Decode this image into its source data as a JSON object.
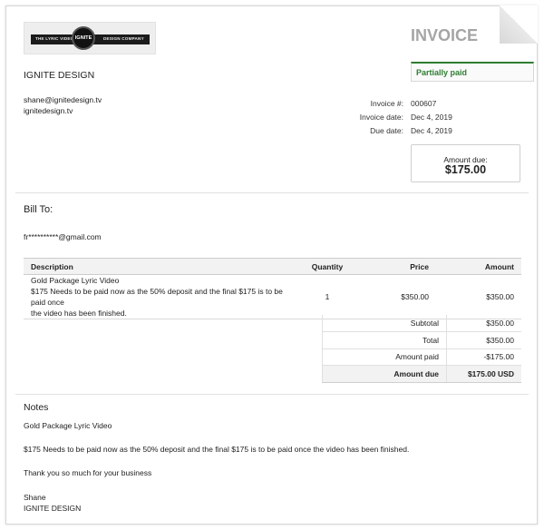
{
  "logo": {
    "left_text": "THE LYRIC VIDEO",
    "center_text": "IGNITE",
    "right_text": "DESIGN COMPANY"
  },
  "company": {
    "name": "IGNITE DESIGN",
    "email": "shane@ignitedesign.tv",
    "website": "ignitedesign.tv"
  },
  "invoice": {
    "title": "INVOICE",
    "status": "Partially paid",
    "status_color": "#2e7d32",
    "number_label": "Invoice #:",
    "number": "000607",
    "date_label": "Invoice date:",
    "date": "Dec 4, 2019",
    "due_label": "Due date:",
    "due_date": "Dec 4, 2019",
    "amount_due_label": "Amount due:",
    "amount_due": "$175.00"
  },
  "bill_to": {
    "title": "Bill To:",
    "email": "fr**********@gmail.com"
  },
  "table": {
    "headers": {
      "description": "Description",
      "quantity": "Quantity",
      "price": "Price",
      "amount": "Amount"
    },
    "items": [
      {
        "name": "Gold Package Lyric Video",
        "details": "$175 Needs to be paid now as the 50% deposit and the final $175 is to be paid once",
        "details_cont": "the video has been finished.",
        "quantity": "1",
        "price": "$350.00",
        "amount": "$350.00"
      }
    ]
  },
  "totals": {
    "subtotal_label": "Subtotal",
    "subtotal": "$350.00",
    "total_label": "Total",
    "total": "$350.00",
    "paid_label": "Amount paid",
    "paid": "-$175.00",
    "due_label": "Amount due",
    "due": "$175.00 USD"
  },
  "notes": {
    "title": "Notes",
    "line1": "Gold Package Lyric Video",
    "line2": "$175 Needs to be paid now as the 50% deposit and the final $175 is to be paid once the video has been finished.",
    "line3": "Thank you so much for your business",
    "signature_name": "Shane",
    "signature_company": "IGNITE DESIGN"
  }
}
